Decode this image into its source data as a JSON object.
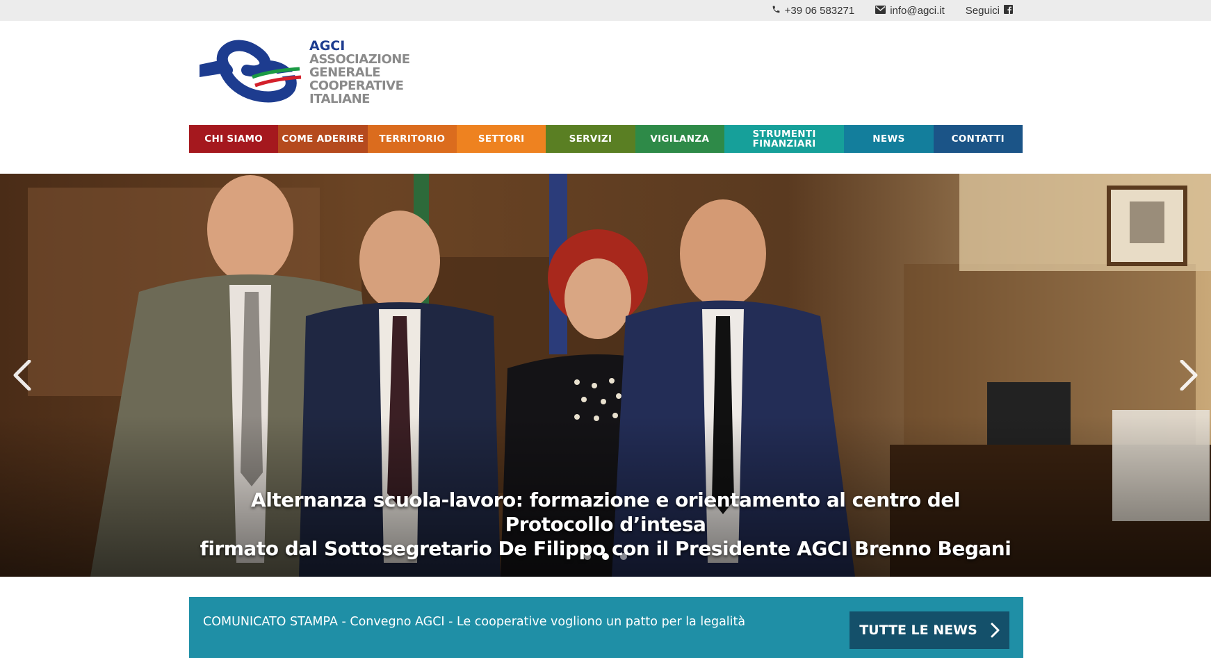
{
  "topbar": {
    "phone": "+39 06 583271",
    "email": "info@agci.it",
    "follow": "Seguici",
    "icons": [
      "phone-icon",
      "envelope-icon",
      "facebook-icon"
    ]
  },
  "logo": {
    "acronym": "AGCI",
    "line1": "ASSOCIAZIONE",
    "line2": "GENERALE",
    "line3": "COOPERATIVE",
    "line4": "ITALIANE"
  },
  "nav": {
    "items": [
      {
        "label": "CHI SIAMO",
        "color": "#a5181e"
      },
      {
        "label": "COME ADERIRE",
        "color": "#b54a1e"
      },
      {
        "label": "TERRITORIO",
        "color": "#db6c1e"
      },
      {
        "label": "SETTORI",
        "color": "#ee8220"
      },
      {
        "label": "SERVIZI",
        "color": "#5a7f23"
      },
      {
        "label": "VIGILANZA",
        "color": "#2e8a48"
      },
      {
        "label": "STRUMENTI FINANZIARI",
        "color": "#16a09a"
      },
      {
        "label": "NEWS",
        "color": "#137e9c"
      },
      {
        "label": "CONTATTI",
        "color": "#1b5487"
      }
    ]
  },
  "hero": {
    "caption_line1": "Alternanza scuola-lavoro: formazione e orientamento al centro del Protocollo d’intesa",
    "caption_line2": "firmato dal Sottosegretario De Filippo con il Presidente AGCI Brenno Begani",
    "slides_count": 3,
    "active_slide": 2
  },
  "newsbar": {
    "headline": "COMUNICATO STAMPA - Convegno AGCI - Le cooperative vogliono un patto per la legalità",
    "button": "TUTTE LE NEWS"
  }
}
